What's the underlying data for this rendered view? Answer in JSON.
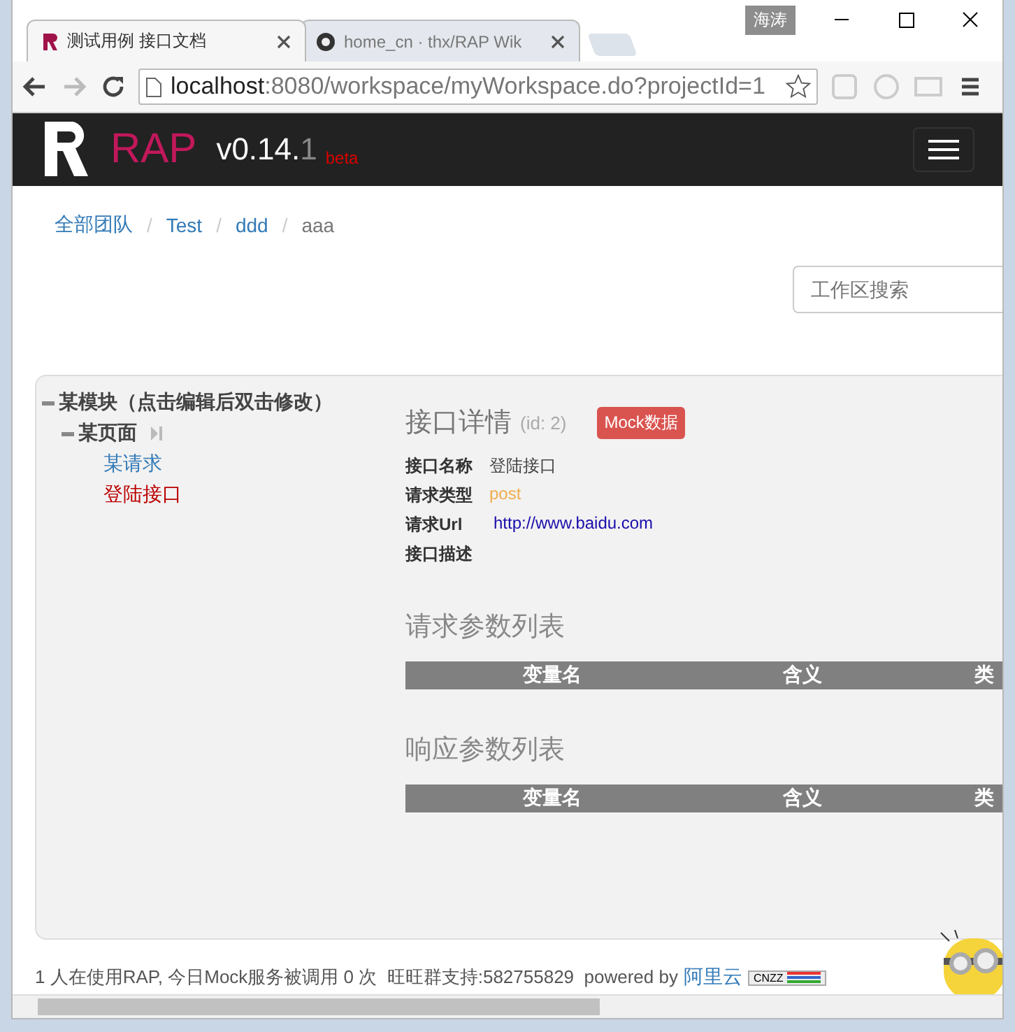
{
  "window": {
    "user_tag": "海涛"
  },
  "tabs": [
    {
      "title": "测试用例 接口文档",
      "selected": true
    },
    {
      "title": "home_cn · thx/RAP Wik",
      "selected": false
    }
  ],
  "address_bar": {
    "host": "localhost",
    "rest": ":8080/workspace/myWorkspace.do?projectId=1"
  },
  "navbar": {
    "brand": "RAP",
    "version": "v0.14.",
    "version_minor": "1",
    "badge": "beta"
  },
  "breadcrumb": {
    "separator": "/",
    "items": [
      {
        "label": "全部团队",
        "kind": "link"
      },
      {
        "label": "Test",
        "kind": "link"
      },
      {
        "label": "ddd",
        "kind": "link"
      },
      {
        "label": "aaa",
        "kind": "current"
      }
    ]
  },
  "search": {
    "placeholder": "工作区搜索"
  },
  "tree": [
    {
      "label": "某模块（点击编辑后双击修改）",
      "expanded": true,
      "children": [
        {
          "label": "某页面",
          "expanded": true,
          "children": [
            {
              "label": "某请求",
              "selected": false
            },
            {
              "label": "登陆接口",
              "selected": true
            }
          ]
        }
      ]
    }
  ],
  "detail": {
    "title": "接口详情",
    "id": "(id: 2)",
    "mock_button": "Mock数据",
    "fields": [
      {
        "label": "接口名称",
        "value": "登陆接口",
        "kind": "text"
      },
      {
        "label": "请求类型",
        "value": "post",
        "kind": "method"
      },
      {
        "label": "请求Url",
        "value": "http://www.baidu.com",
        "kind": "link"
      },
      {
        "label": "接口描述"
      }
    ],
    "sections": [
      {
        "title": "请求参数列表",
        "columns": [
          "变量名",
          "含义",
          "类"
        ]
      },
      {
        "title": "响应参数列表",
        "columns": [
          "变量名",
          "含义",
          "类"
        ]
      }
    ]
  },
  "footer": {
    "text": "1 人在使用RAP, 今日Mock服务被调用 0 次  旺旺群支持:582755829  powered by",
    "link": "阿里云",
    "badge": "CNZZ"
  }
}
